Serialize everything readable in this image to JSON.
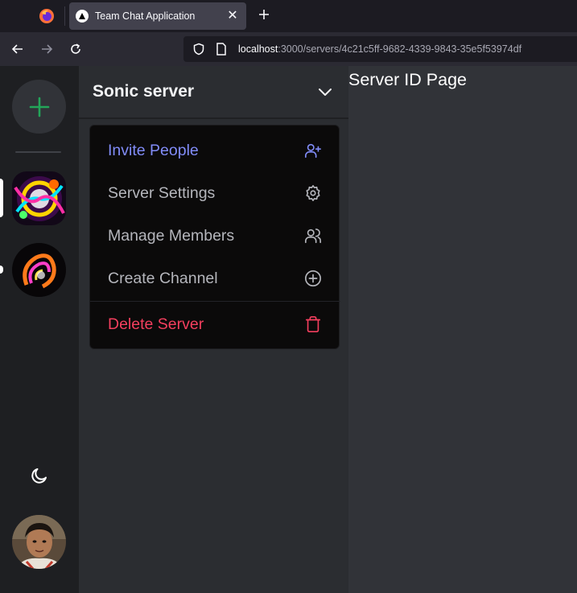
{
  "browser": {
    "tab": {
      "title": "Team Chat Application",
      "close_icon": "close-icon",
      "favicon": "nextjs-triangle-icon"
    },
    "new_tab_icon": "plus-icon",
    "nav": {
      "back_icon": "arrow-left-icon",
      "forward_icon": "arrow-right-icon",
      "reload_icon": "reload-icon"
    },
    "url": {
      "host": "localhost",
      "path": ":3000/servers/4c21c5ff-9682-4339-9843-35e5f53974df"
    }
  },
  "server_rail": {
    "add_server_icon": "plus-icon",
    "accent": "#23a559",
    "servers": [
      {
        "name": "server-1",
        "active": true
      },
      {
        "name": "server-2",
        "active": false
      }
    ],
    "theme_icon": "moon-icon"
  },
  "sidebar": {
    "server_name": "Sonic server",
    "dropdown_icon": "chevron-down-icon",
    "menu": [
      {
        "label": "Invite People",
        "icon": "user-plus-icon",
        "color": "#818cf8"
      },
      {
        "label": "Server Settings",
        "icon": "gear-icon",
        "color": "#b5b6bc"
      },
      {
        "label": "Manage Members",
        "icon": "users-icon",
        "color": "#b5b6bc"
      },
      {
        "label": "Create Channel",
        "icon": "plus-circle-icon",
        "color": "#b5b6bc"
      },
      {
        "label": "Delete Server",
        "icon": "trash-icon",
        "color": "#f43f5e"
      }
    ]
  },
  "main": {
    "title": "Server ID Page"
  }
}
